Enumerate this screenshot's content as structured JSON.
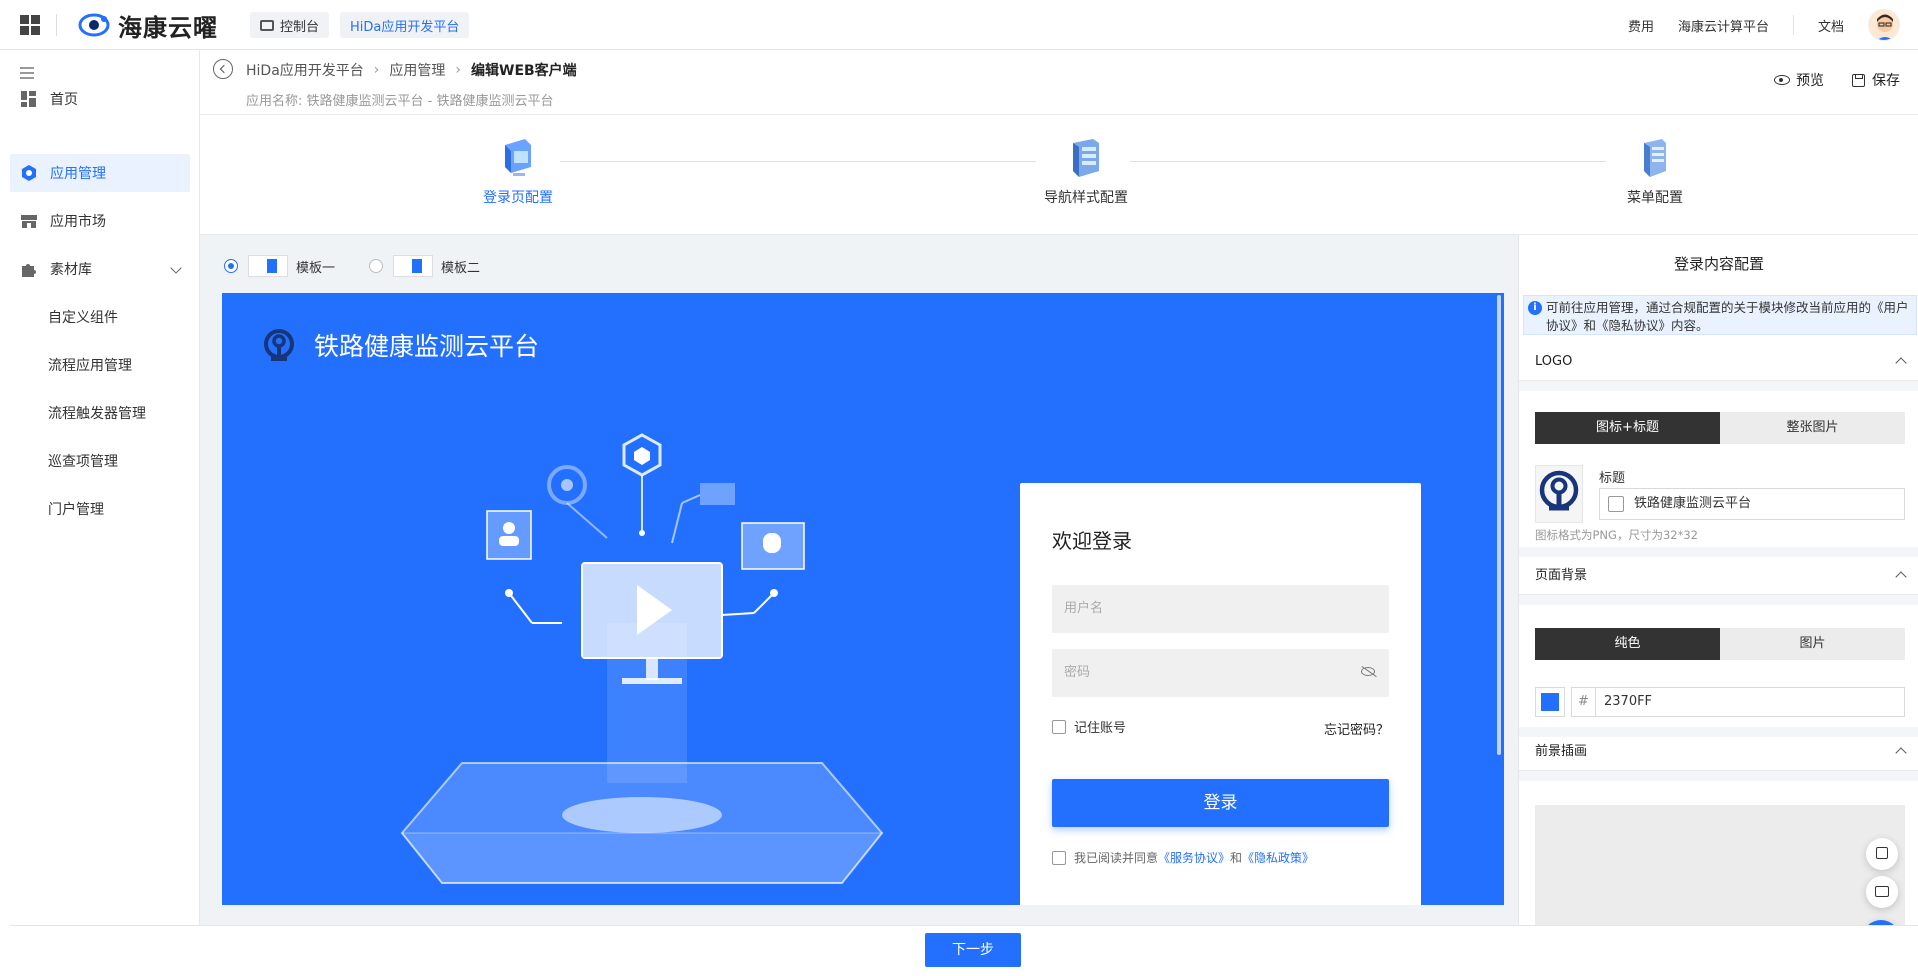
{
  "topbar": {
    "brand": "海康云曜",
    "console_label": "控制台",
    "platform_label": "HiDa应用开发平台",
    "links": [
      "费用",
      "海康云计算平台",
      "文档"
    ]
  },
  "sidebar": {
    "items": [
      {
        "label": "首页",
        "icon": "home-icon"
      },
      {
        "label": "应用管理",
        "icon": "gear-icon"
      },
      {
        "label": "应用市场",
        "icon": "store-icon"
      },
      {
        "label": "素材库",
        "icon": "puzzle-icon"
      }
    ],
    "sub_items": [
      "自定义组件",
      "流程应用管理",
      "流程触发器管理",
      "巡查项管理",
      "门户管理"
    ]
  },
  "header": {
    "breadcrumb": [
      "HiDa应用开发平台",
      "应用管理",
      "编辑WEB客户端"
    ],
    "app_name": "应用名称: 铁路健康监测云平台 - 铁路健康监测云平台",
    "preview_label": "预览",
    "save_label": "保存"
  },
  "steps": [
    {
      "label": "登录页配置",
      "active": true
    },
    {
      "label": "导航样式配置",
      "active": false
    },
    {
      "label": "菜单配置",
      "active": false
    }
  ],
  "templates": {
    "option1": "模板一",
    "option2": "模板二",
    "selected": "模板一"
  },
  "preview": {
    "title": "铁路健康监测云平台",
    "login": {
      "heading": "欢迎登录",
      "username_placeholder": "用户名",
      "password_placeholder": "密码",
      "remember_label": "记住账号",
      "forgot_label": "忘记密码？",
      "submit_label": "登录",
      "agree_prefix": "我已阅读并同意",
      "service_link": "《服务协议》",
      "and": "和",
      "privacy_link": "《隐私政策》"
    },
    "background_color": "#2370FF"
  },
  "config": {
    "title": "登录内容配置",
    "notice": "可前往应用管理，通过合规配置的关于模块修改当前应用的《用户协议》和《隐私协议》内容。",
    "logo_section": {
      "header": "LOGO",
      "mode_options": [
        "图标+标题",
        "整张图片"
      ],
      "selected_mode": "图标+标题",
      "title_label": "标题",
      "title_value": "铁路健康监测云平台",
      "hint": "图标格式为PNG，尺寸为32*32"
    },
    "background_section": {
      "header": "页面背景",
      "mode_options": [
        "纯色",
        "图片"
      ],
      "selected_mode": "纯色",
      "hash": "#",
      "hex_value": "2370FF"
    },
    "foreground_section": {
      "header": "前景插画"
    }
  },
  "footer": {
    "next_label": "下一步"
  }
}
